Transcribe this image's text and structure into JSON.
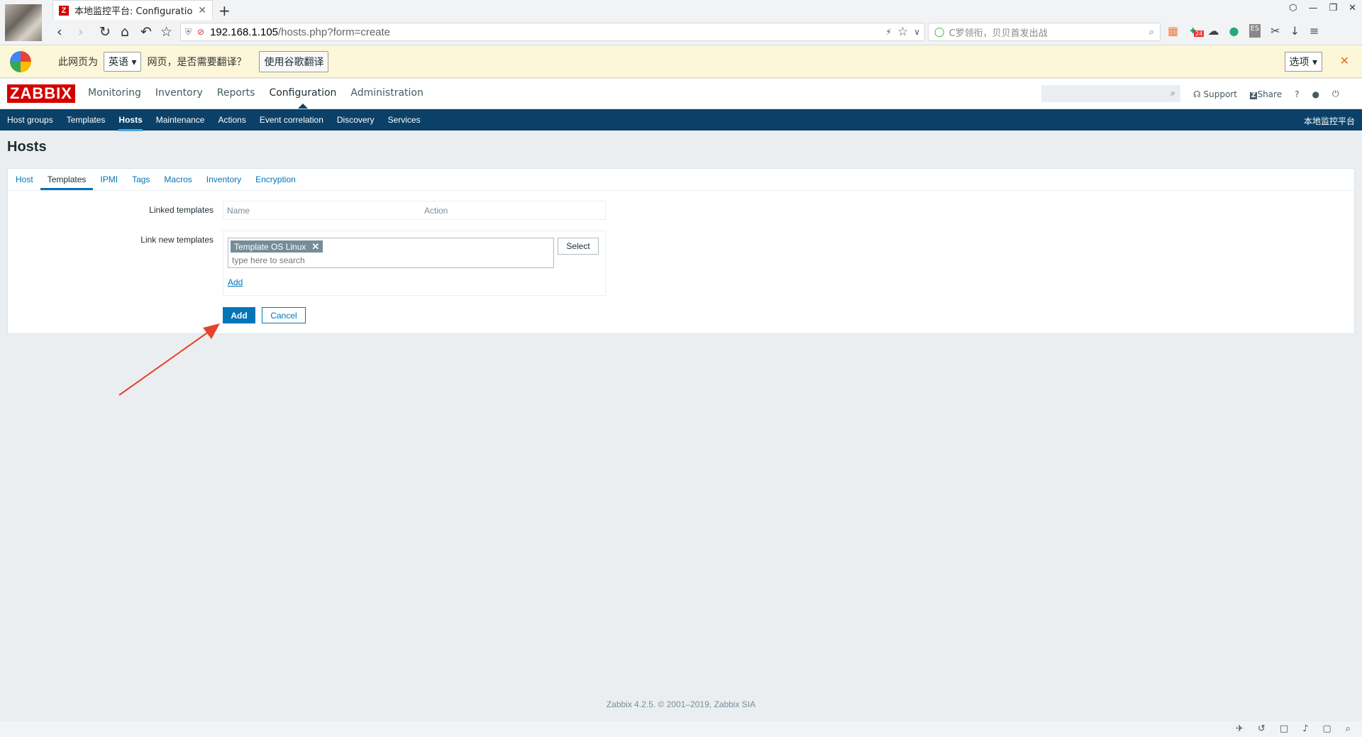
{
  "browser": {
    "tab_title": "本地监控平台: Configuration o",
    "tab_close": "✕",
    "new_tab": "+",
    "url_host": "192.168.1.105",
    "url_path": "/hosts.php?form=create",
    "search_placeholder": "C罗领衔，贝贝首发出战",
    "window_controls": [
      "⬡",
      "—",
      "❐",
      "✕"
    ],
    "extension_badge": "24"
  },
  "translate_bar": {
    "prefix": "此网页为",
    "language": "英语",
    "suffix": "网页，是否需要翻译？",
    "translate_button": "使用谷歌翻译",
    "options": "选项",
    "close": "✕"
  },
  "header": {
    "logo": "ZABBIX",
    "menu": [
      "Monitoring",
      "Inventory",
      "Reports",
      "Configuration",
      "Administration"
    ],
    "active_menu": "Configuration",
    "support": "Support",
    "share": "Share",
    "help": "?"
  },
  "submenu": {
    "items": [
      "Host groups",
      "Templates",
      "Hosts",
      "Maintenance",
      "Actions",
      "Event correlation",
      "Discovery",
      "Services"
    ],
    "active": "Hosts",
    "server_name": "本地监控平台"
  },
  "page": {
    "title": "Hosts",
    "tabs": [
      "Host",
      "Templates",
      "IPMI",
      "Tags",
      "Macros",
      "Inventory",
      "Encryption"
    ],
    "active_tab": "Templates",
    "linked_templates_label": "Linked templates",
    "col_name": "Name",
    "col_action": "Action",
    "link_new_label": "Link new templates",
    "selected_template": "Template OS Linux",
    "search_placeholder": "type here to search",
    "select_button": "Select",
    "add_link": "Add",
    "add_button": "Add",
    "cancel_button": "Cancel"
  },
  "footer": {
    "text": "Zabbix 4.2.5. © 2001–2019, ",
    "link": "Zabbix SIA"
  },
  "colors": {
    "brand_red": "#d40000",
    "submenu_bg": "#0b4168",
    "link_blue": "#0275b8",
    "annotation_arrow": "#e8412c"
  }
}
